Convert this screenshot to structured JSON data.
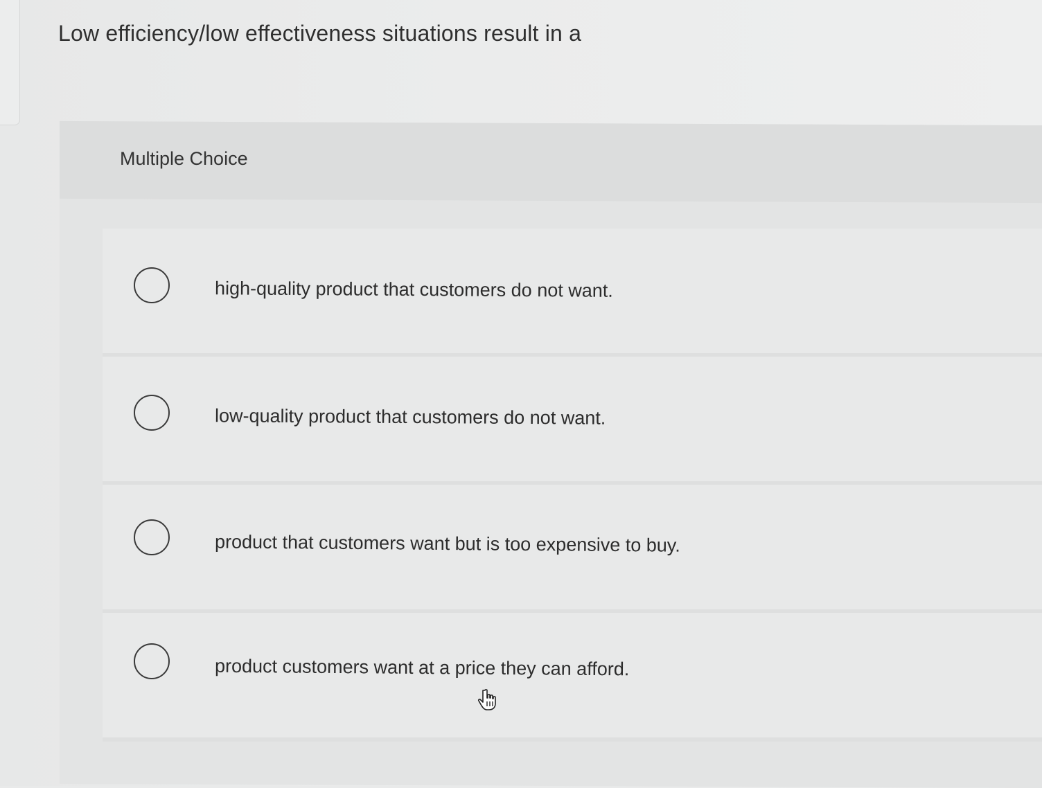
{
  "question": {
    "text": "Low efficiency/low effectiveness situations result in a"
  },
  "section_label": "Multiple Choice",
  "options": [
    {
      "label": "high-quality product that customers do not want.",
      "selected": false
    },
    {
      "label": "low-quality product that customers do not want.",
      "selected": false
    },
    {
      "label": "product that customers want but is too expensive to buy.",
      "selected": false
    },
    {
      "label": "product customers want at a price they can afford.",
      "selected": false
    }
  ],
  "cursor": {
    "icon": "hand-pointer-icon"
  }
}
